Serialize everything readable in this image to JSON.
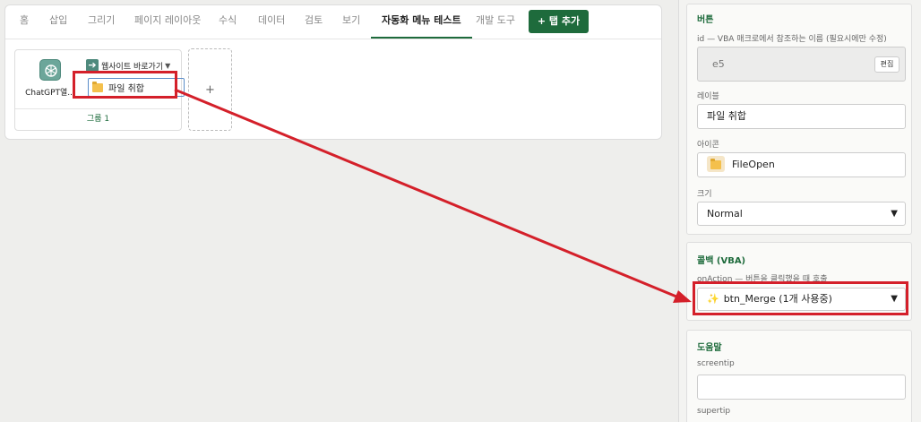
{
  "ribbon": {
    "tabs": [
      "홈",
      "삽입",
      "그리기",
      "페이지 레이아웃",
      "수식",
      "데이터",
      "검토",
      "보기",
      "자동화 메뉴 테스트",
      "개발 도구"
    ],
    "active_tab_index": 8,
    "add_tab_label": "+ 탭 추가",
    "group": {
      "big_button_label": "ChatGPT열...",
      "website_button_label": "웹사이트 바로가기",
      "file_button_label": "파일 취합",
      "footer_label": "그룹 1"
    },
    "add_group_label": "+"
  },
  "panel": {
    "button_section": {
      "title": "버튼",
      "id_label": "id — VBA 매크로에서 참조하는 이름 (필요시에만 수정)",
      "id_value": "e5",
      "edit_label": "편집",
      "label_label": "레이블",
      "label_value": "파일 취합",
      "icon_label": "아이콘",
      "icon_value": "FileOpen",
      "size_label": "크기",
      "size_value": "Normal"
    },
    "callback_section": {
      "title": "콜백 (VBA)",
      "onaction_label": "onAction — 버튼을 클릭했을 때 호출",
      "onaction_value": "btn_Merge (1개 사용중)"
    },
    "help_section": {
      "title": "도움말",
      "screentip_label": "screentip",
      "screentip_value": "",
      "supertip_label": "supertip"
    }
  },
  "colors": {
    "accent_green": "#1e6b3c",
    "highlight_red": "#d4202a"
  }
}
